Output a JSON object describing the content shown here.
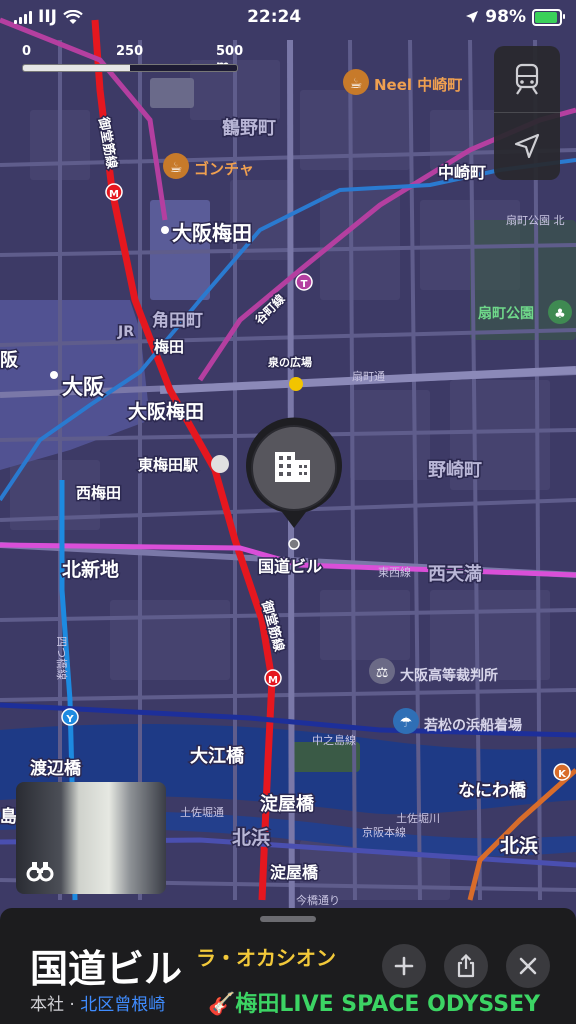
{
  "status_bar": {
    "carrier": "IIJ",
    "time": "22:24",
    "battery": "98%",
    "battery_level": 0.98
  },
  "scale": {
    "ticks": [
      "0",
      "250",
      "500 m"
    ]
  },
  "map": {
    "places": {
      "osaka_umeda": "大阪梅田",
      "tsurunocho": "鶴野町",
      "nakazakicho": "中崎町",
      "kakudacho": "角田町",
      "umeda": "梅田",
      "osaka": "大阪",
      "osaka_umeda2": "大阪梅田",
      "higashi_umeda": "東梅田駅",
      "nishi_umeda": "西梅田",
      "kita_shinchi": "北新地",
      "nozakicho": "野崎町",
      "nishi_temma": "西天満",
      "oebashi": "大江橋",
      "watanabebashi": "渡辺橋",
      "yodoyabashi": "淀屋橋",
      "yodoyabashi2": "淀屋橋",
      "kitahama": "北浜",
      "kitahama2": "北浜",
      "naniwabashi": "なにわ橋",
      "izumi_hiroba": "泉の広場",
      "ogimachi_park": "扇町公園",
      "ogimachi_park_n": "扇町公園 北",
      "ogimachi_dori": "扇町通",
      "kokudo_building": "国道ビル",
      "edge_ka": "阪",
      "edge_shima": "島"
    },
    "pois": {
      "neel": "Neel 中崎町",
      "gongcha": "ゴンチャ",
      "court": "大阪高等裁判所",
      "pier": "若松の浜船着場"
    },
    "lines": {
      "midosuji_a": "御堂筋線",
      "midosuji_b": "御堂筋線",
      "tanimachi": "谷町線",
      "tozai": "東西線",
      "yotsubashi": "四つ橋線",
      "nakanoshima": "中之島線",
      "keihan": "京阪本線",
      "tosabori_a": "土佐堀通",
      "tosabori_b": "土佐堀川",
      "jr": "JR",
      "ichibashi": "今橋通り"
    },
    "line_badges": {
      "midosuji": "M",
      "tanimachi": "T",
      "yotsubashi": "Y",
      "sakaisuji": "K"
    },
    "colors": {
      "midosuji": "#e5171f",
      "tanimachi": "#b43fa0",
      "yotsubashi": "#1d8ae0",
      "tozai": "#d94fd8",
      "keihan": "#4a4fb0",
      "sakaisuji": "#d86c2a",
      "park": "#3a5a46",
      "water": "#1e3a86"
    }
  },
  "place_card": {
    "title": "国道ビル",
    "tagline": "ラ・オカシオン",
    "category": "本社",
    "separator": " · ",
    "area": "北区曾根崎",
    "nearby": "🎸梅田LIVE SPACE ODYSSEY"
  },
  "icons": {
    "transit": "train-icon",
    "location": "location-arrow-icon",
    "add": "plus-icon",
    "share": "share-icon",
    "close": "close-icon",
    "look_around": "binoculars-icon",
    "building": "building-icon"
  }
}
